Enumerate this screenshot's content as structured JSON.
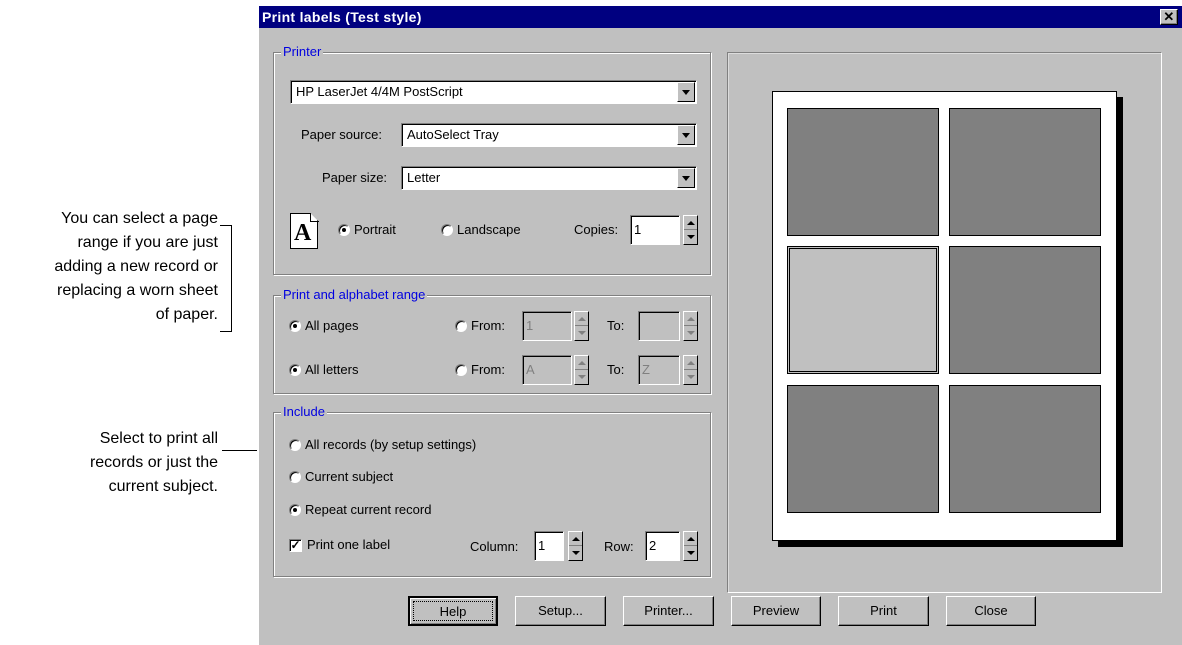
{
  "annotations": {
    "page_range_note": [
      "You can select a page",
      "range if you are just",
      "adding a new record or",
      "replacing a worn sheet",
      "of paper."
    ],
    "include_note": [
      "Select to print all",
      "records or just the",
      "current subject."
    ]
  },
  "window": {
    "title": "Print labels (Test style)",
    "close_glyph": "✕"
  },
  "printer_group": {
    "legend": "Printer",
    "printer_value": "HP LaserJet 4/4M PostScript",
    "paper_source_label": "Paper source:",
    "paper_source_value": "AutoSelect Tray",
    "paper_size_label": "Paper size:",
    "paper_size_value": "Letter",
    "orientation_icon_glyph": "A",
    "portrait_label": "Portrait",
    "landscape_label": "Landscape",
    "orientation_selected": "Portrait",
    "copies_label": "Copies:",
    "copies_value": "1"
  },
  "range_group": {
    "legend": "Print and alphabet range",
    "all_pages_label": "All pages",
    "from_pages_label": "From:",
    "from_pages_value": "1",
    "to_pages_label": "To:",
    "to_pages_value": "",
    "all_letters_label": "All letters",
    "from_letters_label": "From:",
    "from_letters_value": "A",
    "to_letters_label": "To:",
    "to_letters_value": "Z"
  },
  "include_group": {
    "legend": "Include",
    "all_records_label": "All records (by setup settings)",
    "current_subject_label": "Current subject",
    "repeat_record_label": "Repeat current record",
    "selected": "Repeat current record",
    "print_one_label": "Print one label",
    "print_one_checked": true,
    "check_glyph": "✓",
    "column_label": "Column:",
    "column_value": "1",
    "row_label": "Row:",
    "row_value": "2"
  },
  "buttons": {
    "help": "Help",
    "setup": "Setup...",
    "printer": "Printer...",
    "preview": "Preview",
    "print": "Print",
    "close": "Close"
  },
  "preview": {
    "columns": 2,
    "rows": 3,
    "selected_label": {
      "column": 1,
      "row": 2
    }
  },
  "colors": {
    "title_bar": "#000080",
    "group_legend": "#0000e0",
    "dialog_face": "#c0c0c0",
    "label_filled": "#808080"
  }
}
